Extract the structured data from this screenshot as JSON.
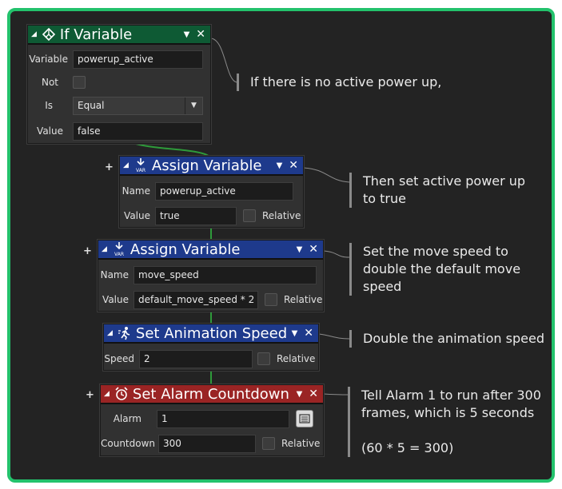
{
  "blocks": {
    "if_variable": {
      "title": "If Variable",
      "variable_label": "Variable",
      "variable_value": "powerup_active",
      "not_label": "Not",
      "is_label": "Is",
      "is_value": "Equal",
      "value_label": "Value",
      "value_value": "false"
    },
    "assign_1": {
      "title": "Assign Variable",
      "name_label": "Name",
      "name_value": "powerup_active",
      "value_label": "Value",
      "value_value": "true",
      "relative_label": "Relative"
    },
    "assign_2": {
      "title": "Assign Variable",
      "name_label": "Name",
      "name_value": "move_speed",
      "value_label": "Value",
      "value_value": "default_move_speed * 2",
      "relative_label": "Relative"
    },
    "anim_speed": {
      "title": "Set Animation Speed",
      "speed_label": "Speed",
      "speed_value": "2",
      "relative_label": "Relative"
    },
    "alarm": {
      "title": "Set Alarm Countdown",
      "alarm_label": "Alarm",
      "alarm_value": "1",
      "countdown_label": "Countdown",
      "countdown_value": "300",
      "relative_label": "Relative"
    }
  },
  "var_badge": "VAR",
  "add_symbol": "+",
  "collapse_symbol": "◢",
  "menu_symbol": "▼",
  "close_symbol": "✕",
  "comments": {
    "c1": "If there is no active power up,",
    "c2_l1": "Then set active power up",
    "c2_l2": "to true",
    "c3_l1": "Set the move speed to",
    "c3_l2": "double the default move",
    "c3_l3": "speed",
    "c4": "Double the animation speed",
    "c5_l1": "Tell Alarm 1 to run after 300",
    "c5_l2": "frames, which is 5 seconds",
    "c5_l3": "(60 * 5 = 300)"
  },
  "colors": {
    "frame_border": "#23c26c",
    "header_green": "#0e5a34",
    "header_blue": "#1e3a8c",
    "header_red": "#9a2424",
    "wire": "#2e9a3a"
  }
}
